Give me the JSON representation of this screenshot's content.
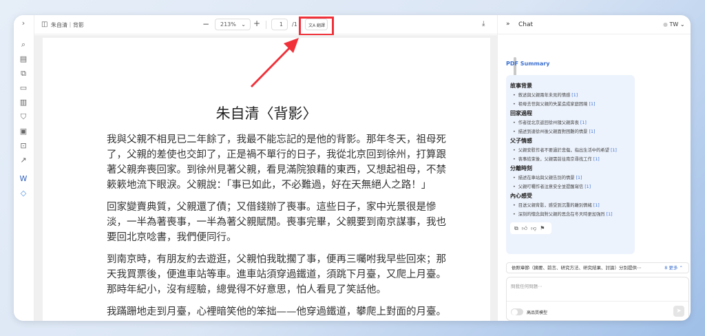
{
  "toolbar": {
    "doc_title": "朱自清｜背影",
    "zoom": "213%",
    "page_current": "1",
    "page_total": "/1",
    "translate_label": "翻譯"
  },
  "document": {
    "title": "朱自清〈背影〉",
    "paragraphs": [
      [
        "我與父親不相見已二年餘了，我最不能忘記的是他的背影。那年冬天，祖母死",
        "了，父親的差使也交卸了，正是禍不單行的日子，我從北京回到徐州，打算跟",
        "著父親奔喪回家。到徐州見著父親，看見滿院狼藉的東西，又想起祖母，不禁",
        "簌簌地流下眼淚。父親說：「事已如此，不必難過，好在天無絕人之路！」"
      ],
      [
        "回家變賣典質，父親還了債；又借錢辦了喪事。這些日子，家中光景很是慘",
        "淡，一半為著喪事，一半為著父親賦閒。喪事完畢，父親要到南京謀事，我也",
        "要回北京唸書，我們便同行。"
      ],
      [
        "到南京時，有朋友約去遊逛，父親怕我耽擱了事，便再三囑咐我早些回來；那",
        "天我買票後，便進車站等車。進車站須穿過鐵道，須跳下月臺，又爬上月臺。",
        "那時年紀小，沒有經驗，總覺得不好意思，怕人看見了笑話他。"
      ],
      [
        "我蹣跚地走到月臺，心裡暗笑他的笨拙——他穿過鐵道，攀爬上對面的月臺。"
      ]
    ]
  },
  "chat": {
    "title": "Chat",
    "lang": "TW",
    "summary_title": "PDF Summary",
    "sections": [
      {
        "heading": "故事背景",
        "items": [
          "敘述與父親兩年未見的情感",
          "祖母去世與父親的失業造成家庭困境"
        ]
      },
      {
        "heading": "回家過程",
        "items": [
          "作者從北京返回徐州隨父親奔喪",
          "描述到達徐州後父親面對困難的情景"
        ]
      },
      {
        "heading": "父子情感",
        "items": [
          "父親安慰作者不要過於悲傷，指出生活中的希望",
          "喪事結束後，父親需前往南京尋找工作"
        ]
      },
      {
        "heading": "分離時刻",
        "items": [
          "描述在車站與父親告別的情景",
          "父親叮囑作者注意安全並提醒寫信"
        ]
      },
      {
        "heading": "內心感受",
        "items": [
          "目送父親背影，感受到沉重的離別情緒",
          "深刻的懷念與對父親的思念在冬天時更加強烈"
        ]
      }
    ],
    "ref": "[1]",
    "suggestion": "依照章節（摘要、前言、研究方法、研究結果、討論）分別提供⋯",
    "more": "8 更多 ⌃",
    "input_placeholder": "問我任何問題⋯",
    "model_toggle": "高品質模型"
  },
  "colors": {
    "accent": "#3a6fd0",
    "highlight": "#f0313a"
  }
}
